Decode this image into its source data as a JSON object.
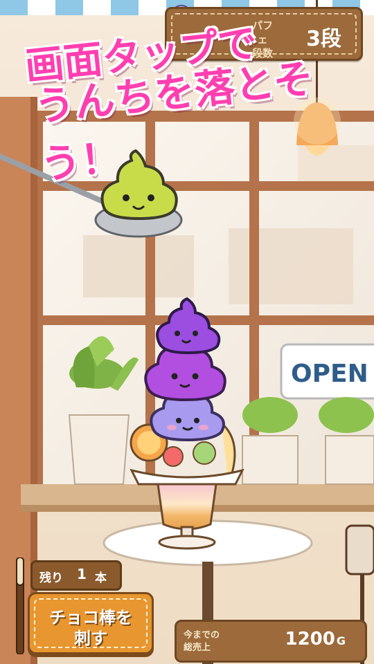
{
  "hud": {
    "tier_label_line1": "パフェ",
    "tier_label_line2": "段数",
    "tier_value": "3段"
  },
  "headline": {
    "line1": "画面タップで",
    "line2": "うんちを落とそう！"
  },
  "sign": {
    "open": "OPEN"
  },
  "remaining": {
    "label": "残り",
    "count": "1",
    "unit": "本"
  },
  "action_button": {
    "line1": "チョコ棒を",
    "line2": "刺す"
  },
  "sales": {
    "caption_line1": "今までの",
    "caption_line2": "総売上",
    "value": "1200",
    "unit": "G"
  },
  "colors": {
    "headline": "#ff3fb0",
    "panel_brown": "#9c6a3b",
    "button_orange": "#e8962f",
    "held_poop": "#c8dc4a",
    "stack_top": "#9b4ee0",
    "stack_mid": "#b24fe0",
    "stack_bottom": "#a89bef"
  }
}
